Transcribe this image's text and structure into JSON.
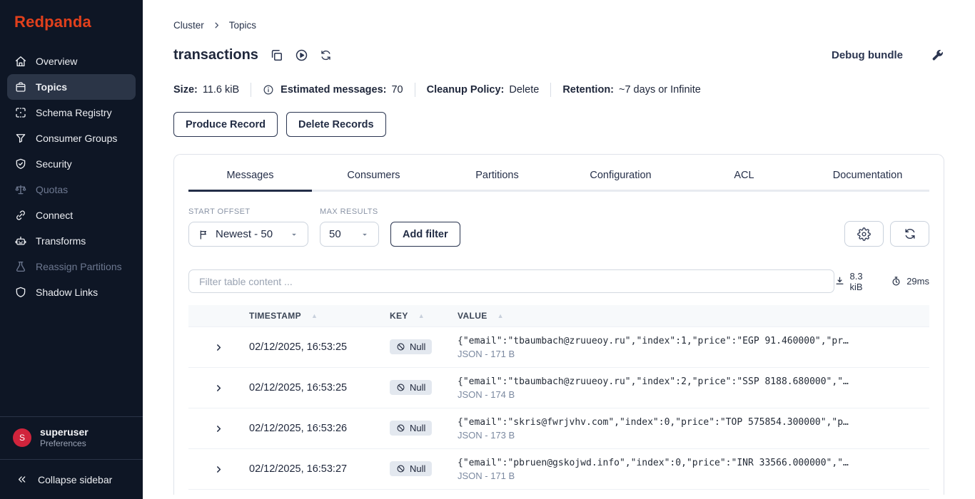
{
  "colors": {
    "brand_red": "#e2401c",
    "sidebar_bg": "#0e1625",
    "avatar_red": "#d0243c",
    "accent_dark": "#232e48"
  },
  "sidebar": {
    "logo": "Redpanda",
    "items": [
      {
        "label": "Overview",
        "icon": "home",
        "active": false,
        "disabled": false
      },
      {
        "label": "Topics",
        "icon": "topics",
        "active": true,
        "disabled": false
      },
      {
        "label": "Schema Registry",
        "icon": "schema",
        "active": false,
        "disabled": false
      },
      {
        "label": "Consumer Groups",
        "icon": "funnel",
        "active": false,
        "disabled": false
      },
      {
        "label": "Security",
        "icon": "shield-check",
        "active": false,
        "disabled": false
      },
      {
        "label": "Quotas",
        "icon": "scales",
        "active": false,
        "disabled": true
      },
      {
        "label": "Connect",
        "icon": "link",
        "active": false,
        "disabled": false
      },
      {
        "label": "Transforms",
        "icon": "robot",
        "active": false,
        "disabled": false
      },
      {
        "label": "Reassign Partitions",
        "icon": "flask",
        "active": false,
        "disabled": true
      },
      {
        "label": "Shadow Links",
        "icon": "shield",
        "active": false,
        "disabled": false
      }
    ],
    "user": {
      "initial": "S",
      "name": "superuser",
      "subtitle": "Preferences"
    },
    "collapse_label": "Collapse sidebar"
  },
  "header": {
    "breadcrumb": [
      "Cluster",
      "Topics"
    ],
    "title": "transactions",
    "debug_bundle_label": "Debug bundle"
  },
  "stats": [
    {
      "label": "Size:",
      "value": "11.6 kiB",
      "info": false
    },
    {
      "label": "Estimated messages:",
      "value": "70",
      "info": true
    },
    {
      "label": "Cleanup Policy:",
      "value": "Delete",
      "info": false
    },
    {
      "label": "Retention:",
      "value": "~7 days or Infinite",
      "info": false
    }
  ],
  "actions": {
    "produce_label": "Produce Record",
    "delete_label": "Delete Records"
  },
  "tabs": [
    {
      "label": "Messages",
      "active": true
    },
    {
      "label": "Consumers",
      "active": false
    },
    {
      "label": "Partitions",
      "active": false
    },
    {
      "label": "Configuration",
      "active": false
    },
    {
      "label": "ACL",
      "active": false
    },
    {
      "label": "Documentation",
      "active": false
    }
  ],
  "controls": {
    "start_offset_label": "START OFFSET",
    "start_offset_value": "Newest - 50",
    "max_results_label": "MAX RESULTS",
    "max_results_value": "50",
    "add_filter_label": "Add filter"
  },
  "filter": {
    "placeholder": "Filter table content ...",
    "fetched_size": "8.3 kiB",
    "fetch_time": "29ms"
  },
  "table": {
    "columns": [
      "TIMESTAMP",
      "KEY",
      "VALUE"
    ],
    "rows": [
      {
        "timestamp": "02/12/2025, 16:53:25",
        "key": "Null",
        "value": "{\"email\":\"tbaumbach@zruueoy.ru\",\"index\":1,\"price\":\"EGP 91.460000\",\"pr…",
        "meta": "JSON - 171 B"
      },
      {
        "timestamp": "02/12/2025, 16:53:25",
        "key": "Null",
        "value": "{\"email\":\"tbaumbach@zruueoy.ru\",\"index\":2,\"price\":\"SSP 8188.680000\",\"…",
        "meta": "JSON - 174 B"
      },
      {
        "timestamp": "02/12/2025, 16:53:26",
        "key": "Null",
        "value": "{\"email\":\"skris@fwrjvhv.com\",\"index\":0,\"price\":\"TOP 575854.300000\",\"p…",
        "meta": "JSON - 173 B"
      },
      {
        "timestamp": "02/12/2025, 16:53:27",
        "key": "Null",
        "value": "{\"email\":\"pbruen@gskojwd.info\",\"index\":0,\"price\":\"INR 33566.000000\",\"…",
        "meta": "JSON - 171 B"
      }
    ]
  }
}
